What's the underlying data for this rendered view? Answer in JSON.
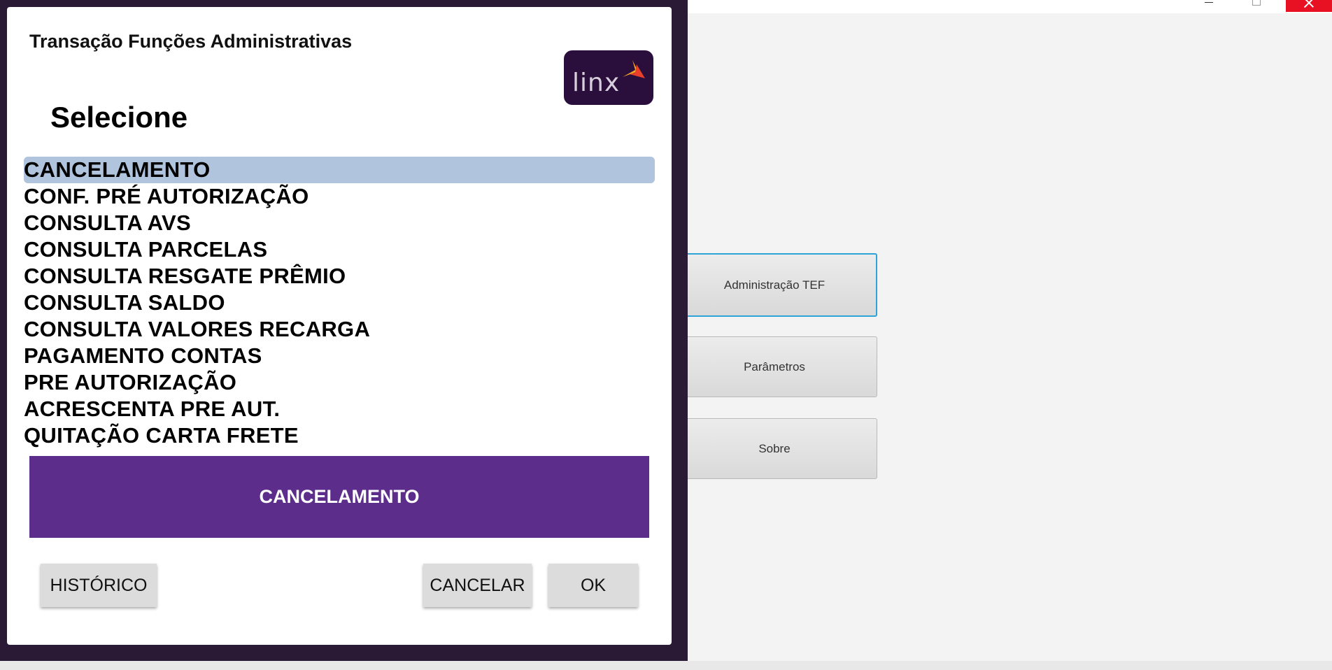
{
  "background_app": {
    "buttons": [
      {
        "label": "Administração TEF"
      },
      {
        "label": "Parâmetros"
      },
      {
        "label": "Sobre"
      }
    ]
  },
  "dialog": {
    "title": "Transação Funções Administrativas",
    "logo_text": "linx",
    "subtitle": "Selecione",
    "items": [
      {
        "label": "CANCELAMENTO",
        "selected": true
      },
      {
        "label": "CONF. PRÉ AUTORIZAÇÃO"
      },
      {
        "label": "CONSULTA AVS"
      },
      {
        "label": "CONSULTA PARCELAS"
      },
      {
        "label": "CONSULTA RESGATE PRÊMIO"
      },
      {
        "label": "CONSULTA SALDO"
      },
      {
        "label": "CONSULTA VALORES RECARGA"
      },
      {
        "label": "PAGAMENTO CONTAS"
      },
      {
        "label": "PRE AUTORIZAÇÃO"
      },
      {
        "label": "ACRESCENTA PRE AUT."
      },
      {
        "label": "QUITAÇÃO CARTA FRETE"
      }
    ],
    "selected_display": "CANCELAMENTO",
    "buttons": {
      "history": "HISTÓRICO",
      "cancel": "CANCELAR",
      "ok": "OK"
    }
  },
  "colors": {
    "frame": "#2b1a35",
    "selection_highlight": "#b0c4de",
    "banner": "#5c2d8a",
    "close_button": "#e81123",
    "focus_border": "#2ea3d8"
  }
}
